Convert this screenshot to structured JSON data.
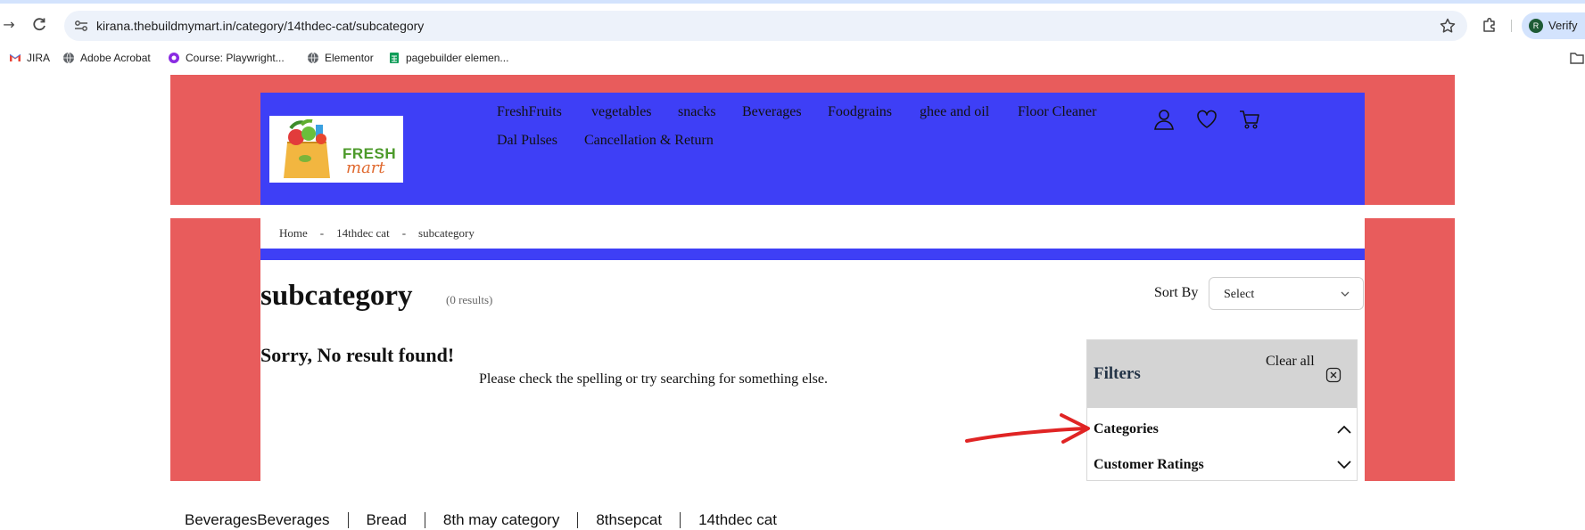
{
  "browser": {
    "url": "kirana.thebuildmymart.in/category/14thdec-cat/subcategory",
    "profile_label": "Verify",
    "profile_initial": "R",
    "bookmarks": [
      {
        "label": "JIRA",
        "icon": "gmail-icon"
      },
      {
        "label": "Adobe Acrobat",
        "icon": "globe-icon"
      },
      {
        "label": "Course: Playwright...",
        "icon": "course-icon"
      },
      {
        "label": "Elementor",
        "icon": "globe-icon"
      },
      {
        "label": "pagebuilder elemen...",
        "icon": "sheets-icon"
      }
    ]
  },
  "header": {
    "logo_fresh": "FRESH",
    "logo_mart": "mart",
    "nav": [
      "FreshFruits",
      "vegetables",
      "snacks",
      "Beverages",
      "Foodgrains",
      "ghee and oil",
      "Floor Cleaner",
      "Dal Pulses",
      "Cancellation & Return"
    ]
  },
  "breadcrumb": [
    "Home",
    "14thdec cat",
    "subcategory"
  ],
  "breadcrumb_separator": "-",
  "page": {
    "title": "subcategory",
    "result_count": "(0 results)",
    "sort_label": "Sort By",
    "sort_value": "Select",
    "no_result_title": "Sorry, No result found!",
    "no_result_subtitle": "Please check the spelling or try searching for something else."
  },
  "filters": {
    "title": "Filters",
    "clear_all": "Clear all",
    "sections": [
      {
        "label": "Categories",
        "expanded": true
      },
      {
        "label": "Customer Ratings",
        "expanded": false
      }
    ]
  },
  "category_strip": [
    "BeveragesBeverages",
    "Bread",
    "8th may category",
    "8thsepcat",
    "14thdec cat"
  ],
  "colors": {
    "accent_red": "#e85c5c",
    "header_blue": "#3e3ff6",
    "annotation_red": "#e02424"
  }
}
